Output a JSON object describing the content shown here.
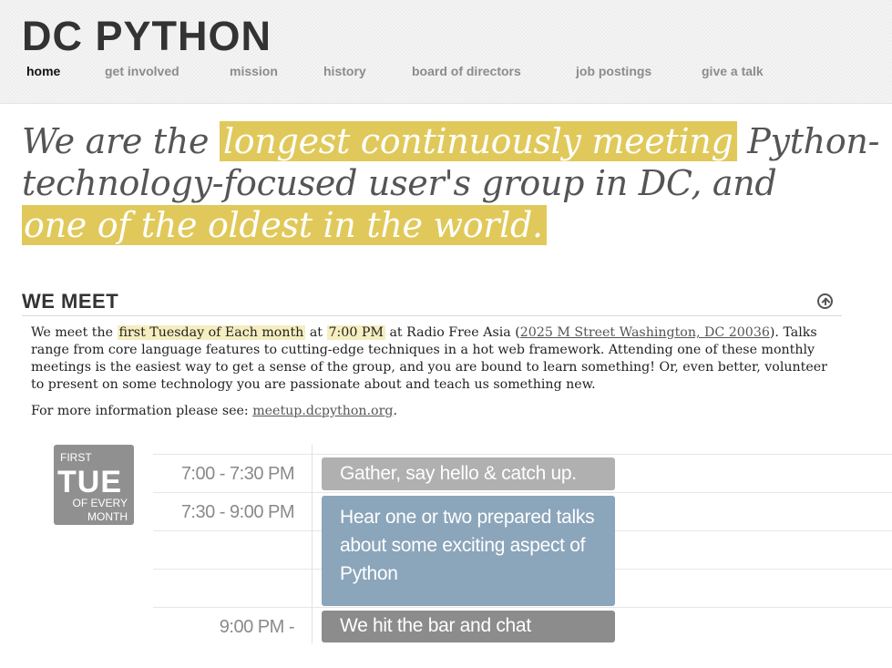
{
  "header": {
    "logo": "DC PYTHON",
    "nav": [
      {
        "label": "home",
        "active": true
      },
      {
        "label": "get involved",
        "active": false
      },
      {
        "label": "mission",
        "active": false
      },
      {
        "label": "history",
        "active": false
      },
      {
        "label": "board of directors",
        "active": false
      },
      {
        "label": "job postings",
        "active": false
      },
      {
        "label": "give a talk",
        "active": false
      }
    ]
  },
  "tagline": {
    "part1": "We are the ",
    "highlight1": "longest continuously meeting",
    "part2": " Python-",
    "line2": "technology-focused user's group in DC, and",
    "highlight2": "one of the oldest in the world."
  },
  "we_meet": {
    "title": "WE MEET",
    "p1_a": "We meet the ",
    "p1_highlight_day": "first Tuesday of Each month",
    "p1_b": " at ",
    "p1_highlight_time": "7:00 PM",
    "p1_c": " at Radio Free Asia (",
    "p1_address_link": "2025 M Street Washington, DC 20036",
    "p1_d": "). Talks range from core language features to cutting-edge techniques in a hot web framework. Attending one of these monthly meetings is the easiest way to get a sense of the group, and you are bound to learn something! Or, even better, volunteer to present on some technology you are passionate about and teach us something new.",
    "p2_a": "For more information please see: ",
    "p2_link": "meetup.dcpython.org",
    "p2_b": "."
  },
  "schedule": {
    "badge": {
      "first": "FIRST",
      "day": "TUE",
      "of_every": "OF EVERY",
      "month": "MONTH"
    },
    "events": [
      {
        "time": "7:00 - 7:30 PM",
        "description": "Gather, say hello & catch up."
      },
      {
        "time": "7:30 - 9:00 PM",
        "description": "Hear one or two prepared talks about some exciting aspect of Python"
      },
      {
        "time": "9:00 PM -",
        "description": "We hit the bar and chat"
      }
    ]
  },
  "colors": {
    "highlight": "#e0c95a",
    "event_gather": "#b0b0b0",
    "event_talks": "#8ba5bb",
    "event_bar": "#8c8c8c"
  }
}
